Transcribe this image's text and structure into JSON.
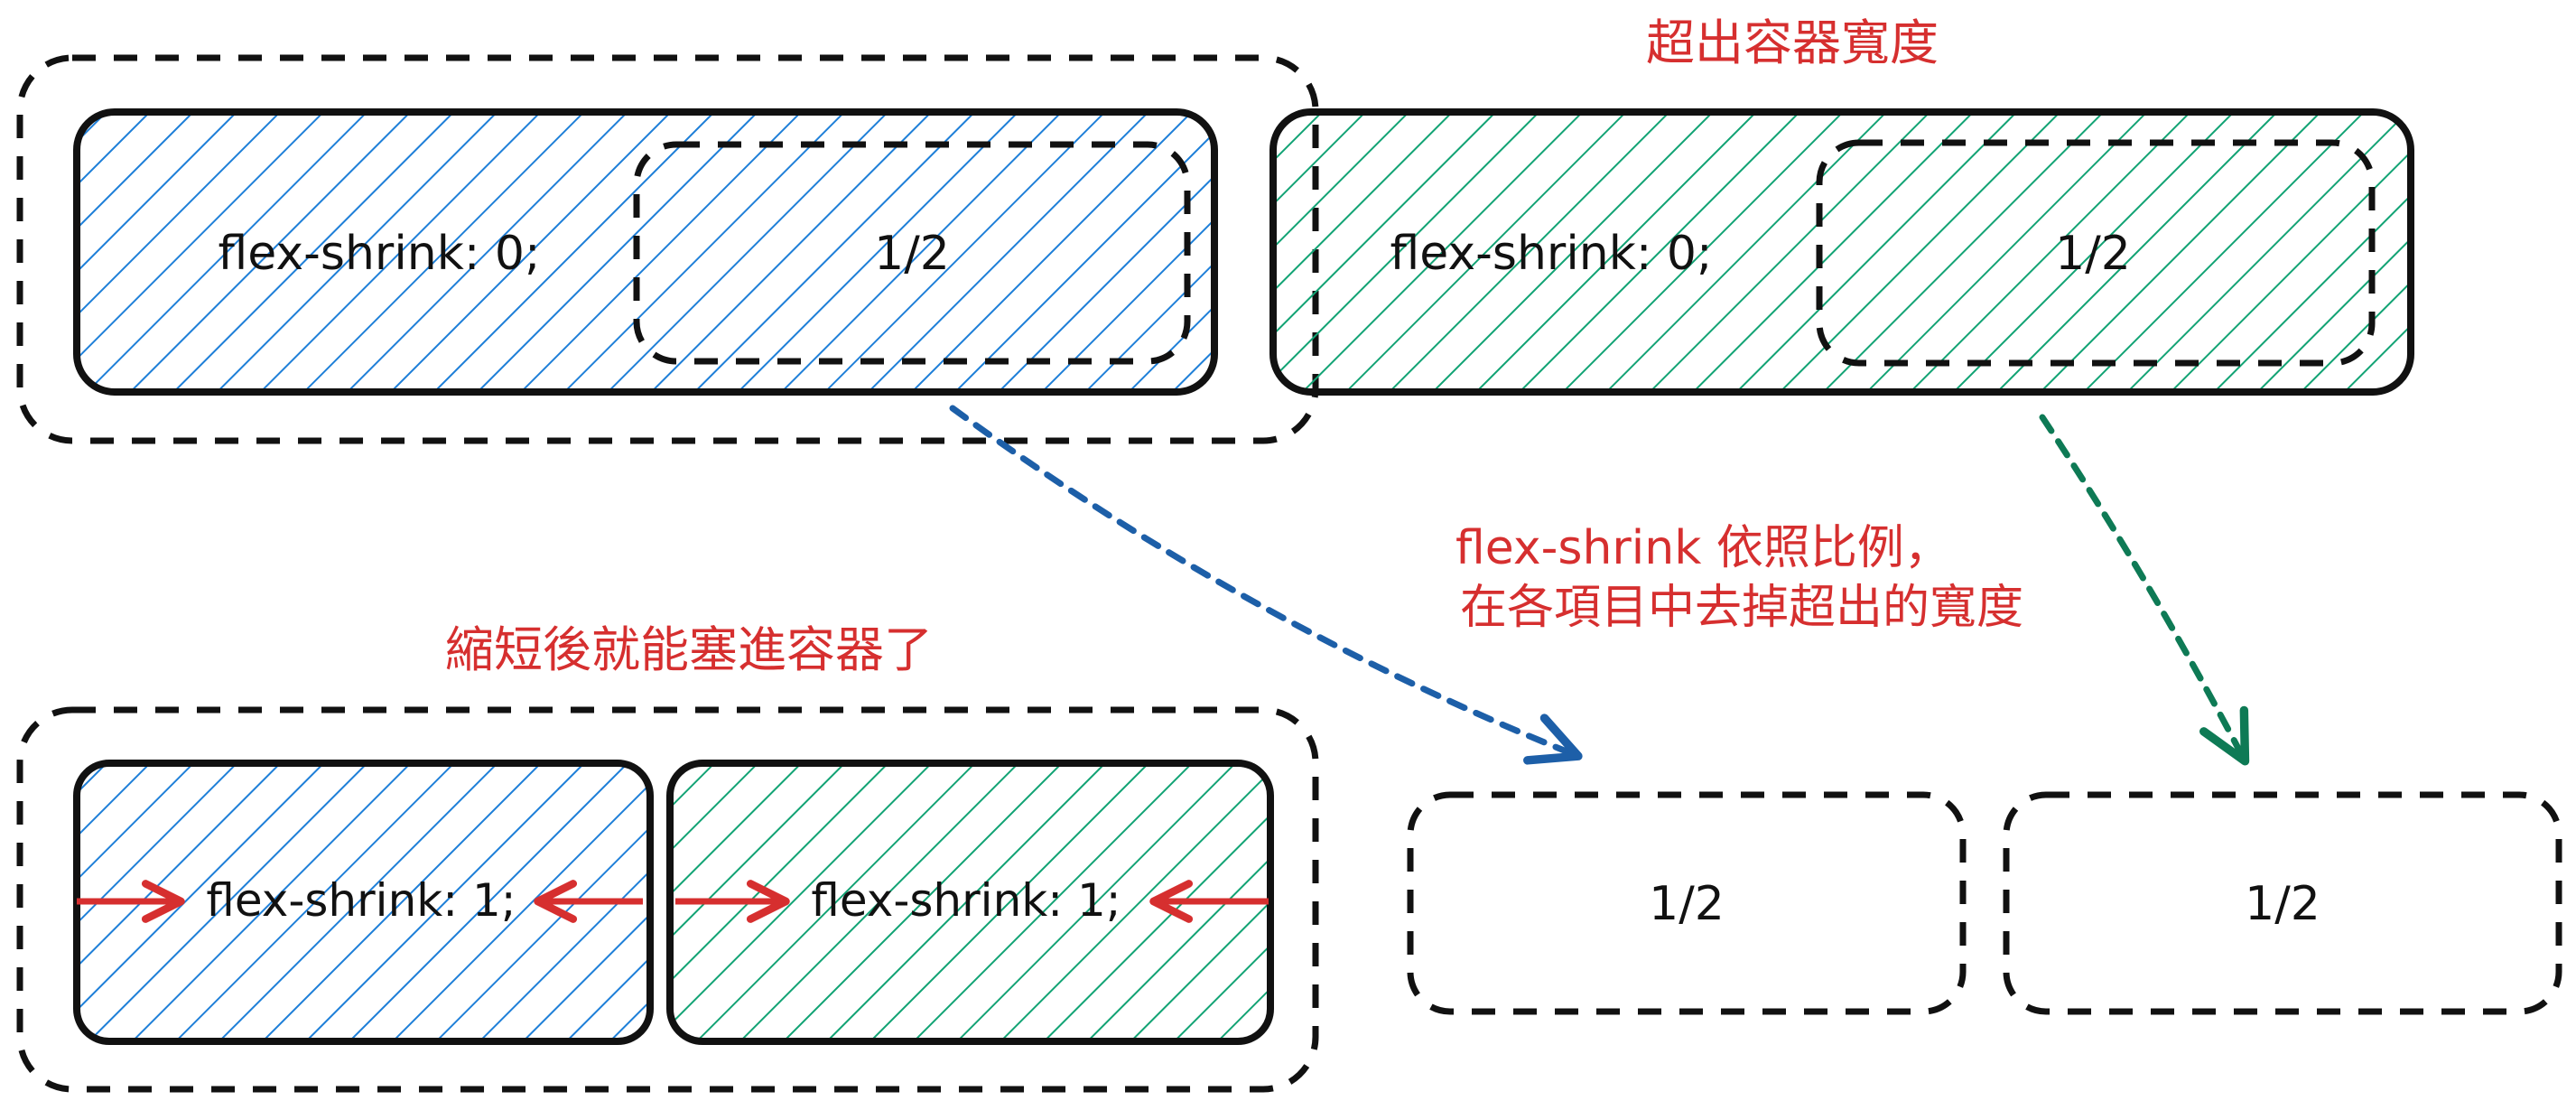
{
  "colors": {
    "blue": "#1e7fd8",
    "green": "#12a374",
    "red": "#d62f2f",
    "ink": "#111111",
    "arrow_blue": "#1d5fa8",
    "arrow_green": "#0e7a55"
  },
  "top_left": {
    "item_label": "flex-shrink: 0;",
    "half_label": "1/2"
  },
  "top_right": {
    "item_label": "flex-shrink: 0;",
    "half_label": "1/2"
  },
  "annotations": {
    "overflow": "超出容器寬度",
    "shrink_keyword": "flex-shrink",
    "shrink_line1_rest": " 依照比例，",
    "shrink_line2": "在各項目中去掉超出的寬度",
    "fits": "縮短後就能塞進容器了"
  },
  "bottom": {
    "item_a_label": "flex-shrink: 1;",
    "item_b_label": "flex-shrink: 1;",
    "half_a_label": "1/2",
    "half_b_label": "1/2"
  }
}
